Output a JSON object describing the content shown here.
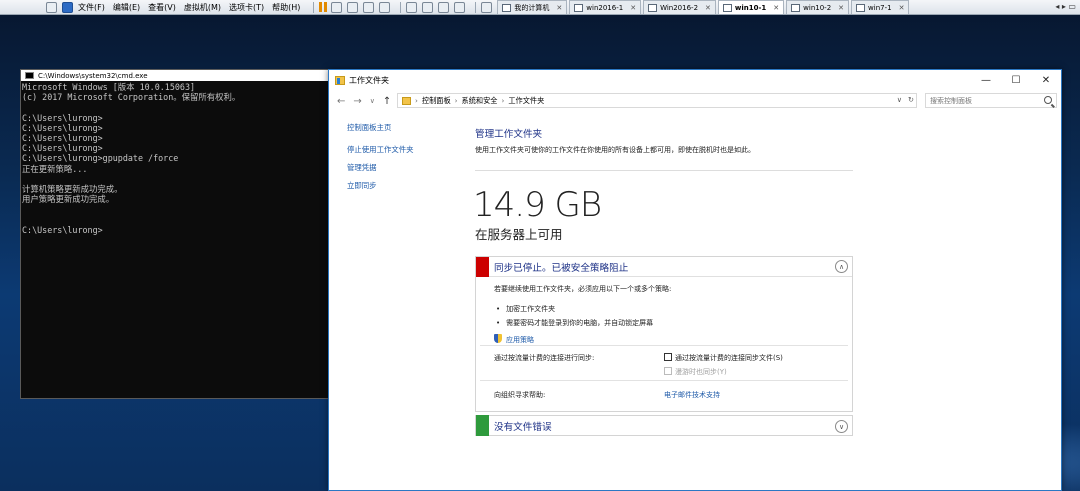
{
  "vmware": {
    "menus": [
      "文件(F)",
      "编辑(E)",
      "查看(V)",
      "虚拟机(M)",
      "选项卡(T)",
      "帮助(H)"
    ],
    "tabs": [
      {
        "label": "我的计算机",
        "active": false
      },
      {
        "label": "win2016-1",
        "active": false
      },
      {
        "label": "Win2016-2",
        "active": false
      },
      {
        "label": "win10-1",
        "active": true
      },
      {
        "label": "win10-2",
        "active": false
      },
      {
        "label": "win7-1",
        "active": false
      }
    ]
  },
  "cmd": {
    "title": "C:\\Windows\\system32\\cmd.exe",
    "lines": [
      "Microsoft Windows [版本 10.0.15063]",
      "(c) 2017 Microsoft Corporation。保留所有权利。",
      "",
      "C:\\Users\\lurong>",
      "C:\\Users\\lurong>",
      "C:\\Users\\lurong>",
      "C:\\Users\\lurong>",
      "C:\\Users\\lurong>gpupdate /force",
      "正在更新策略...",
      "",
      "计算机策略更新成功完成。",
      "用户策略更新成功完成。",
      "",
      "",
      "C:\\Users\\lurong>"
    ]
  },
  "window": {
    "title": "工作文件夹",
    "breadcrumb": [
      "控制面板",
      "系统和安全",
      "工作文件夹"
    ],
    "search_placeholder": "搜索控制面板",
    "sidebar": {
      "home": "控制面板主页",
      "links": [
        "停止使用工作文件夹",
        "管理凭据",
        "立即同步"
      ]
    },
    "heading": "管理工作文件夹",
    "description": "使用工作文件夹可使你的工作文件在你使用的所有设备上都可用，即使在脱机时也是如此。",
    "storage_value": "14.9 GB",
    "storage_label": "在服务器上可用",
    "sync_panel": {
      "title": "同步已停止。已被安全策略阻止",
      "intro": "若要继续使用工作文件夹，必须应用以下一个或多个策略:",
      "policies": [
        "加密工作文件夹",
        "需要密码才能登录到你的电脑，并自动锁定屏幕"
      ],
      "apply_link": "应用策略",
      "metered_label": "通过按流量计费的连接进行同步:",
      "metered_checkbox": "通过按流量计费的连接同步文件(S)",
      "roaming_checkbox": "漫游时也同步(Y)",
      "help_label": "向组织寻求帮助:",
      "help_link": "电子邮件技术支持"
    },
    "errors_panel": {
      "title": "没有文件错误"
    }
  },
  "colors": {
    "sync_stopped": "#cc0000",
    "no_errors": "#2e9a3c",
    "heading_blue": "#1e3287",
    "link_blue": "#1e5aa8"
  }
}
